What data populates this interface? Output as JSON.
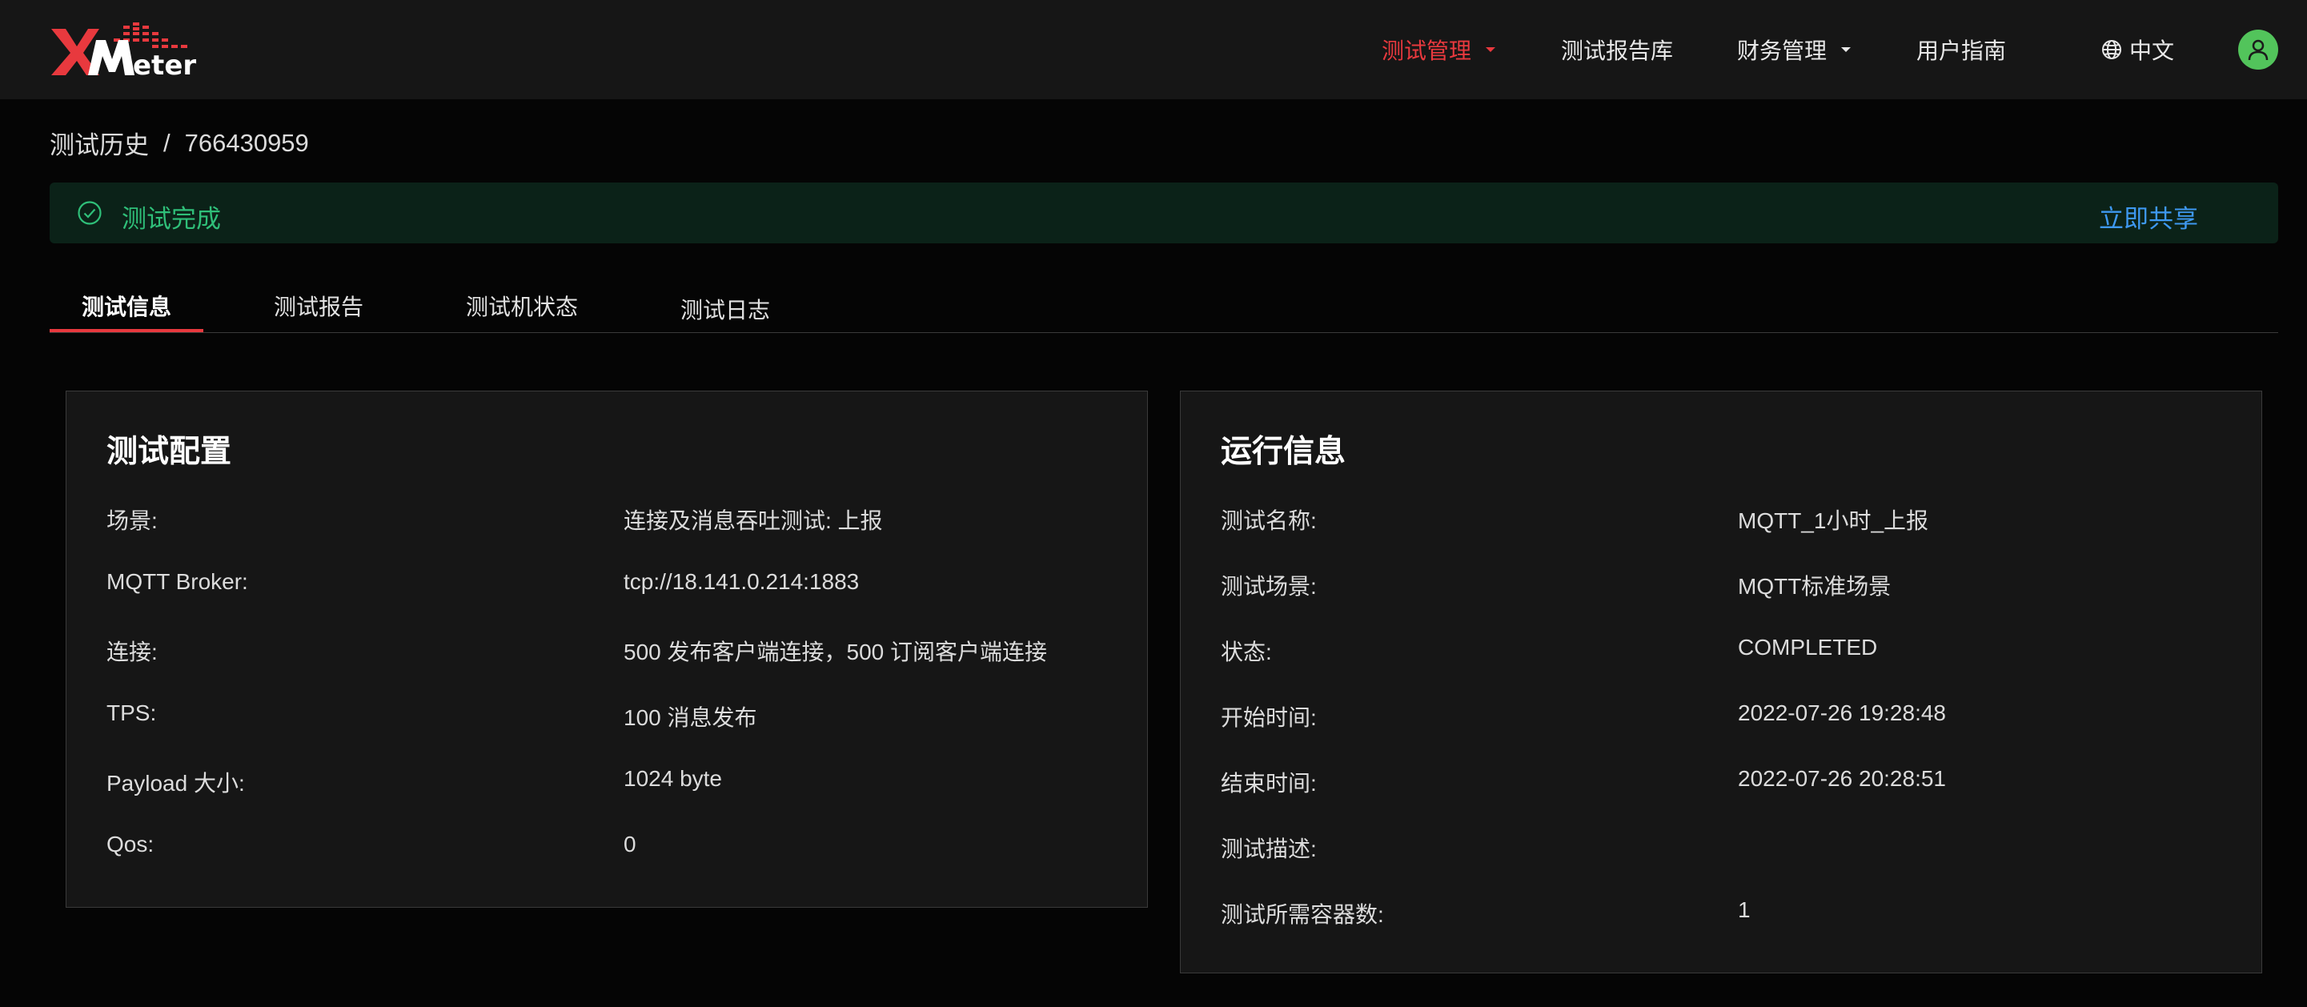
{
  "header": {
    "logo_text": "XMeter",
    "nav": [
      {
        "label": "测试管理",
        "has_dropdown": true,
        "active": true
      },
      {
        "label": "测试报告库",
        "has_dropdown": false,
        "active": false
      },
      {
        "label": "财务管理",
        "has_dropdown": true,
        "active": false
      },
      {
        "label": "用户指南",
        "has_dropdown": false,
        "active": false
      }
    ],
    "language": {
      "icon": "globe-icon",
      "label": "中文"
    },
    "avatar_icon": "user-icon"
  },
  "breadcrumb": {
    "parent": "测试历史",
    "separator": "/",
    "current": "766430959"
  },
  "alert": {
    "icon": "check-circle-icon",
    "text": "测试完成",
    "action": "立即共享"
  },
  "tabs": [
    {
      "label": "测试信息",
      "active": true
    },
    {
      "label": "测试报告",
      "active": false
    },
    {
      "label": "测试机状态",
      "active": false
    },
    {
      "label": "测试日志",
      "active": false
    }
  ],
  "test_config": {
    "title": "测试配置",
    "rows": [
      {
        "label": "场景:",
        "value": "连接及消息吞吐测试: 上报"
      },
      {
        "label": "MQTT Broker:",
        "value": "tcp://18.141.0.214:1883"
      },
      {
        "label": "连接:",
        "value": "500 发布客户端连接，500 订阅客户端连接"
      },
      {
        "label": "TPS:",
        "value": "100 消息发布"
      },
      {
        "label": "Payload 大小:",
        "value": "1024 byte"
      },
      {
        "label": "Qos:",
        "value": "0"
      }
    ]
  },
  "run_info": {
    "title": "运行信息",
    "rows": [
      {
        "label": "测试名称:",
        "value": "MQTT_1小时_上报"
      },
      {
        "label": "测试场景:",
        "value": "MQTT标准场景"
      },
      {
        "label": "状态:",
        "value": "COMPLETED"
      },
      {
        "label": "开始时间:",
        "value": "2022-07-26 19:28:48"
      },
      {
        "label": "结束时间:",
        "value": "2022-07-26 20:28:51"
      },
      {
        "label": "测试描述:",
        "value": ""
      },
      {
        "label": "测试所需容器数:",
        "value": "1"
      }
    ]
  },
  "colors": {
    "accent_red": "#e8393e",
    "success_green": "#2fbf79",
    "link_blue": "#3e98f0",
    "avatar_green": "#52c45b"
  }
}
